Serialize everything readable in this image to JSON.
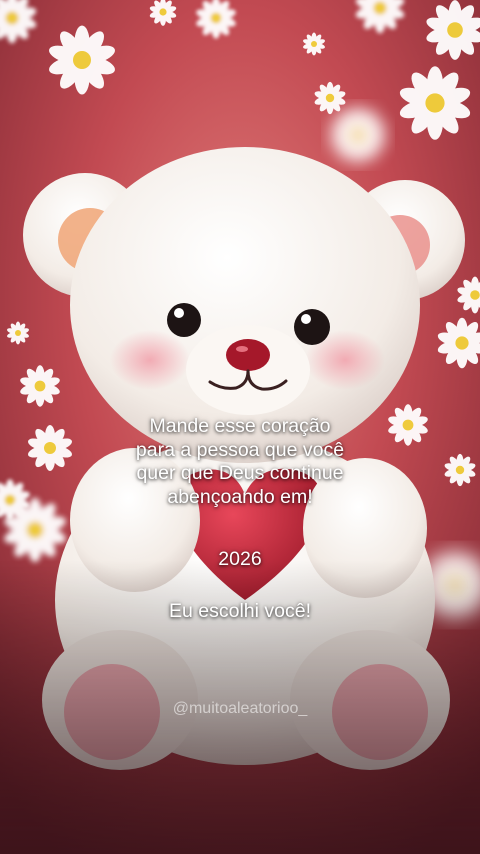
{
  "message": {
    "line1": "Mande esse coração",
    "line2": "para a pessoa que você",
    "line3": "quer que Deus continue",
    "line4": "abençoando em!"
  },
  "year": "2026",
  "closing": "Eu escolhi você!",
  "watermark": "@muitoaleatorioo_",
  "colors": {
    "background": "#c24a52",
    "bear": "#f7f1ec",
    "heart": "#c8283a",
    "flower_center": "#f2d23c"
  }
}
